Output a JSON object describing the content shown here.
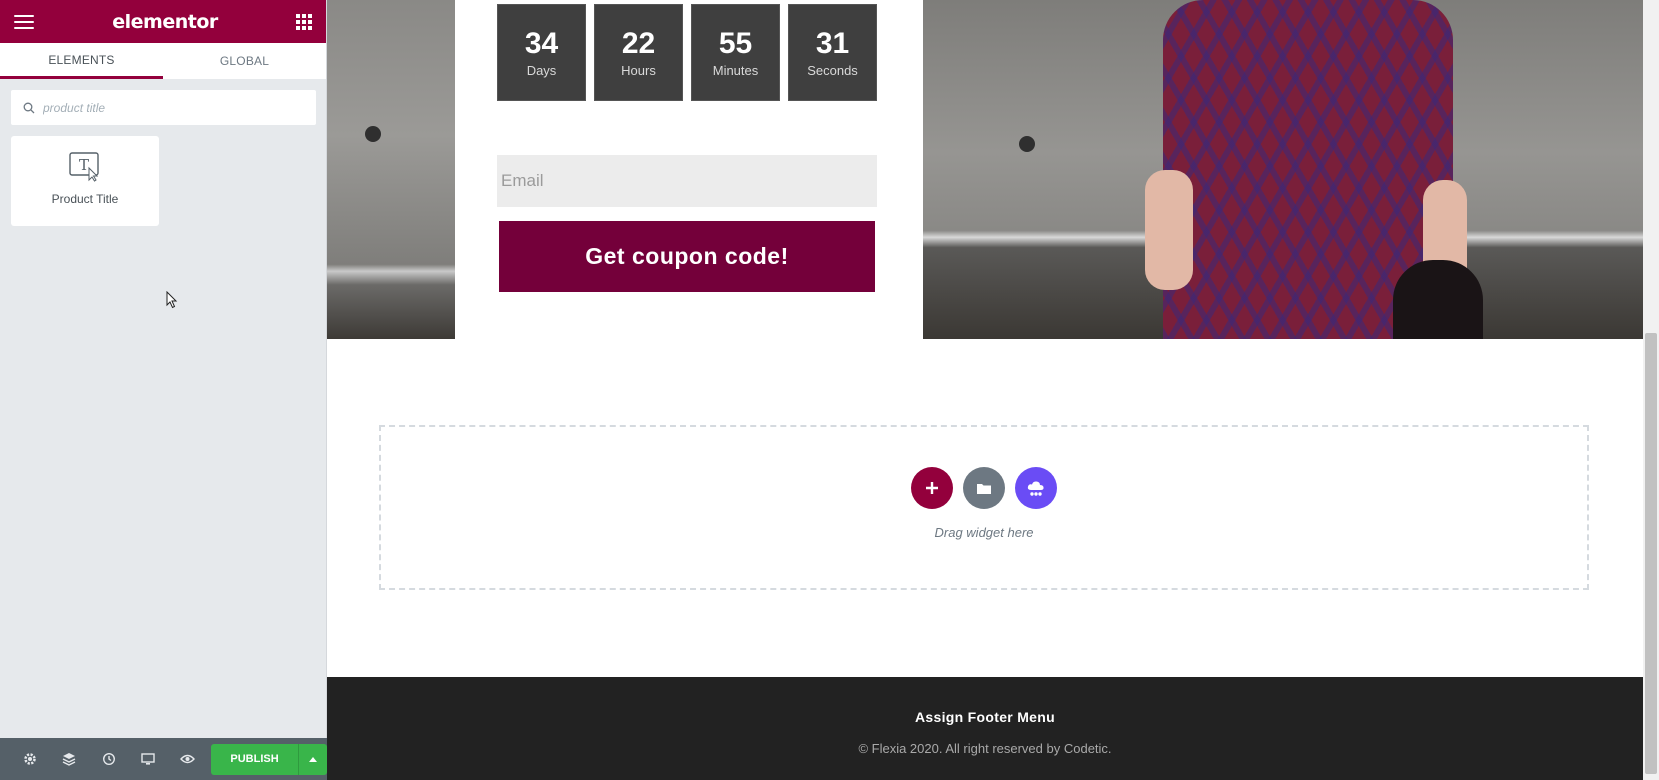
{
  "sidebar": {
    "logo": "elementor",
    "tabs": [
      {
        "label": "ELEMENTS",
        "active": true
      },
      {
        "label": "GLOBAL",
        "active": false
      }
    ],
    "search": {
      "placeholder": "product title"
    },
    "widgets": [
      {
        "label": "Product Title",
        "icon": "text-title-icon"
      }
    ],
    "footer": {
      "icons": [
        "settings-icon",
        "layers-icon",
        "history-icon",
        "responsive-icon",
        "preview-icon"
      ],
      "publish_label": "PUBLISH"
    }
  },
  "canvas": {
    "countdown": [
      {
        "value": "34",
        "label": "Days"
      },
      {
        "value": "22",
        "label": "Hours"
      },
      {
        "value": "55",
        "label": "Minutes"
      },
      {
        "value": "31",
        "label": "Seconds"
      }
    ],
    "email": {
      "placeholder": "Email"
    },
    "coupon_button": "Get coupon code!",
    "drop_zone": {
      "text": "Drag widget here",
      "buttons": [
        "add-section-icon",
        "template-library-icon",
        "cloud-template-icon"
      ]
    },
    "footer": {
      "menu": "Assign Footer Menu",
      "copyright": "© Flexia 2020. All right reserved by Codetic."
    }
  },
  "colors": {
    "brand": "#93003c",
    "coupon": "#74003a",
    "publish": "#39b54a",
    "add_button": "#93003c",
    "folder_button": "#6d7882",
    "cloud_button": "#6a4cf5",
    "footer_bg": "#222222"
  }
}
